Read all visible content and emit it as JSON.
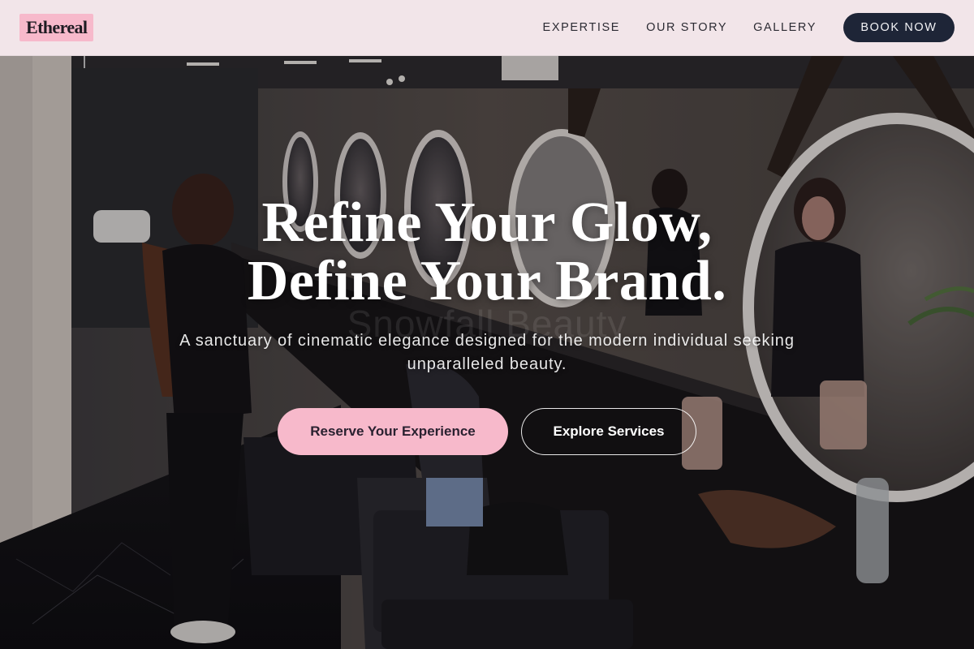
{
  "brand": {
    "logo_text": "Ethereal"
  },
  "nav": {
    "links": [
      "EXPERTISE",
      "OUR STORY",
      "GALLERY"
    ],
    "cta": "BOOK NOW"
  },
  "hero": {
    "headline_line1": "Refine Your Glow,",
    "headline_line2": "Define Your Brand.",
    "watermark": "Snowfall Beauty",
    "subtitle": "A sanctuary of cinematic elegance designed for the modern individual seeking unparalleled beauty.",
    "primary_button": "Reserve Your Experience",
    "secondary_button": "Explore Services"
  },
  "colors": {
    "accent_pink": "#f7b9cb",
    "navy": "#1e2537",
    "header_bg": "#faecf0"
  }
}
